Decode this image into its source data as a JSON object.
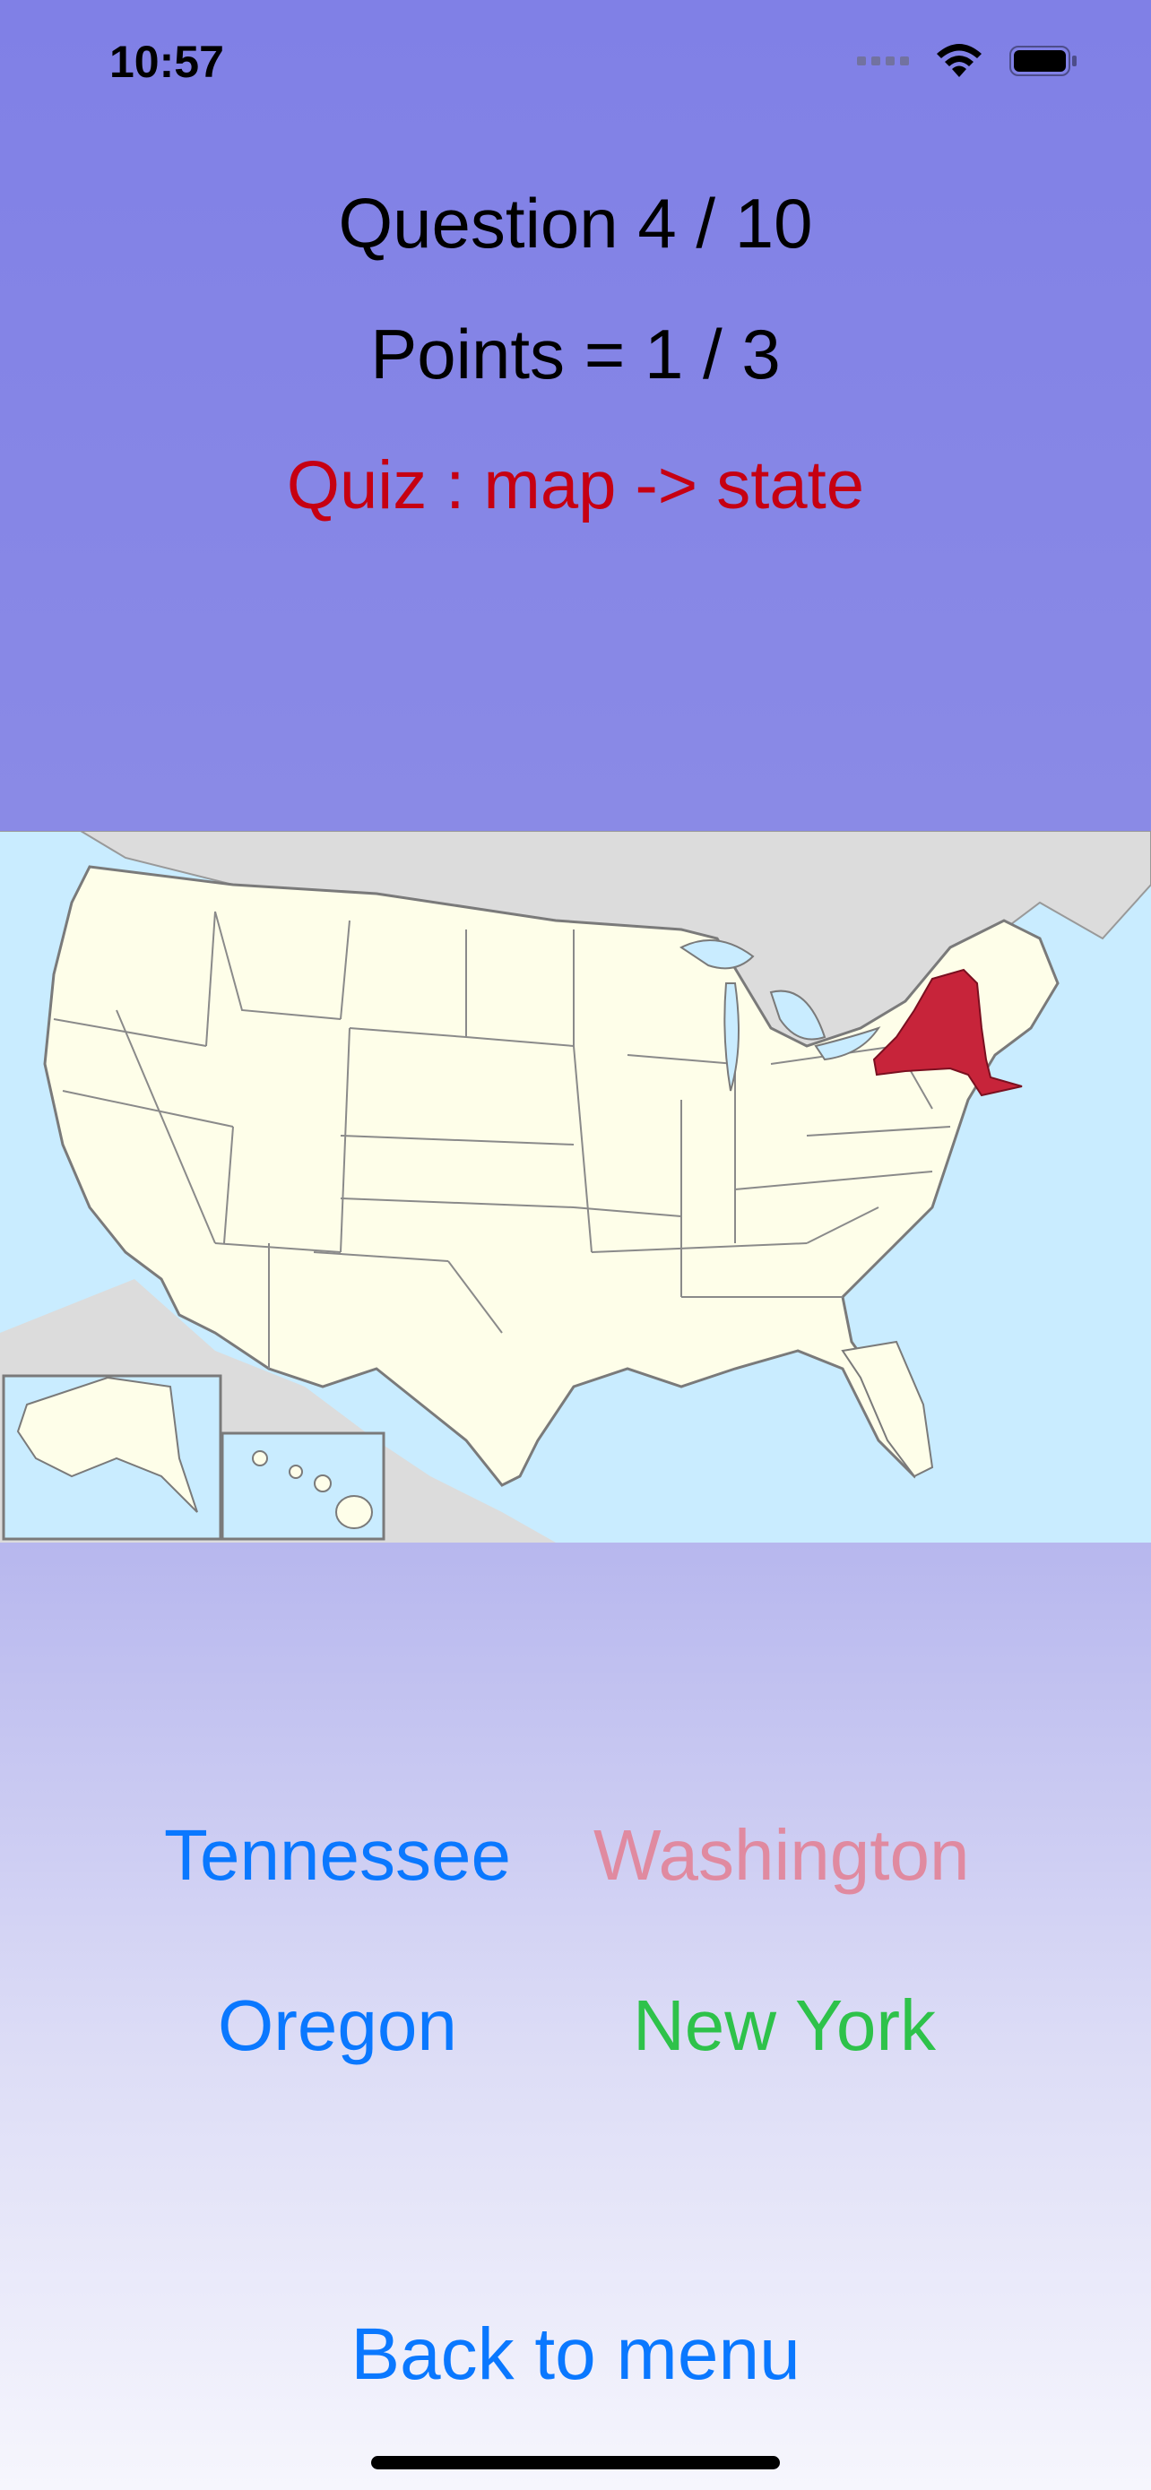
{
  "status_bar": {
    "time": "10:57",
    "icons": [
      "signal-icon",
      "wifi-icon",
      "battery-icon"
    ]
  },
  "header": {
    "question": "Question 4 / 10",
    "points": "Points = 1 / 3",
    "quiz": "Quiz : map -> state"
  },
  "map": {
    "highlighted_state": "New York",
    "highlight_color": "#c7243a",
    "land_color": "#fefee9",
    "water_color": "#c9ecff"
  },
  "answers": [
    {
      "label": "Tennessee",
      "color": "#0a78ff"
    },
    {
      "label": "Washington",
      "color": "#e08aa0"
    },
    {
      "label": "Oregon",
      "color": "#0a78ff"
    },
    {
      "label": "New York",
      "color": "#2ec24a"
    }
  ],
  "footer": {
    "back_label": "Back to menu"
  },
  "colors": {
    "accent": "#0a78ff",
    "quiz_red": "#c60012",
    "correct_green": "#2ec24a",
    "wrong_pink": "#e08aa0",
    "header_bg": "#8080e6"
  }
}
